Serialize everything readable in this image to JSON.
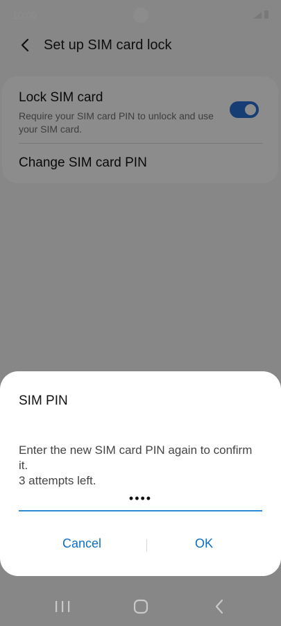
{
  "status_bar": {
    "time": "10:00"
  },
  "header": {
    "title": "Set up SIM card lock"
  },
  "settings": {
    "lock_sim_card": {
      "title": "Lock SIM card",
      "subtitle": "Require your SIM card PIN to unlock and use your SIM card.",
      "enabled": true
    },
    "change_pin": {
      "title": "Change SIM card PIN"
    }
  },
  "dialog": {
    "title": "SIM PIN",
    "message": "Enter the new SIM card PIN again to confirm it.",
    "attempts": "3 attempts left.",
    "pin_value": "••••",
    "buttons": {
      "cancel": "Cancel",
      "ok": "OK"
    }
  },
  "colors": {
    "accent": "#2a6fd6",
    "button_text": "#0b6fc5"
  }
}
